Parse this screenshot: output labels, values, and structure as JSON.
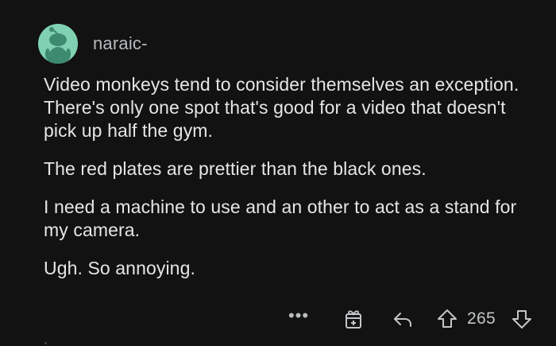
{
  "comment": {
    "author": "naraic-",
    "paragraphs": [
      "Video monkeys tend to consider themselves an exception. There's only one spot that's good for a video that doesn't pick up half the gym.",
      "The red plates are prettier than the black ones.",
      "I need a machine to use and an other to act as a stand for my camera.",
      "Ugh. So annoying."
    ]
  },
  "actions": {
    "more_label": "•••",
    "score": "265"
  },
  "colors": {
    "background": "#121212",
    "text": "#e4e6e8",
    "avatar_bg": "#7fd1b1",
    "avatar_figure": "#3d8a70"
  },
  "icons": {
    "avatar": "snoo-avatar-icon",
    "more": "more-options-icon",
    "award": "award-gift-icon",
    "reply": "reply-arrow-icon",
    "upvote": "upvote-arrow-icon",
    "downvote": "downvote-arrow-icon"
  }
}
